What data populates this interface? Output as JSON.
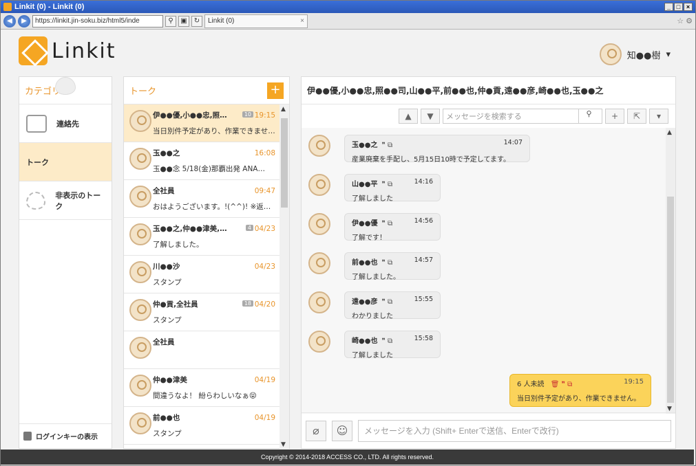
{
  "browser": {
    "window_title": "Linkit (0) - Linkit (0)",
    "address": "https://linkit.jin-soku.biz/html5/inde",
    "tab_label": "Linkit (0)"
  },
  "app": {
    "logo_text": "Linkit",
    "user_name": "知●●樹"
  },
  "category": {
    "header": "カテゴリ",
    "items": [
      {
        "label": "連絡先"
      },
      {
        "label": "トーク"
      },
      {
        "label": "非表示のトーク"
      }
    ],
    "login_key": "ログインキーの表示"
  },
  "talk": {
    "header": "トーク",
    "add_label": "+",
    "items": [
      {
        "name": "伊●●優,小●●忠,照…",
        "message": "当日別件予定があり、作業できませ…",
        "date": "19:15",
        "count": "10"
      },
      {
        "name": "玉●●之",
        "message": "玉●●念 5/18(金)那覇出発 ANA…",
        "date": "16:08",
        "count": ""
      },
      {
        "name": "全社員",
        "message": "おはようございます。!(^^)! ※返…",
        "date": "09:47",
        "count": ""
      },
      {
        "name": "玉●●之,仲●●津美,…",
        "message": "了解しました。",
        "date": "04/23",
        "count": "4"
      },
      {
        "name": "川●●沙",
        "message": "スタンプ",
        "date": "04/23",
        "count": ""
      },
      {
        "name": "仲●貢,全社員",
        "message": "スタンプ",
        "date": "04/20",
        "count": "18"
      },
      {
        "name": "全社員",
        "message": "",
        "date": "",
        "count": ""
      },
      {
        "name": "仲●●津美",
        "message": "間違うなよ！ 紛らわしいなぁ😝",
        "date": "04/19",
        "count": ""
      },
      {
        "name": "前●●也",
        "message": "スタンプ",
        "date": "04/19",
        "count": ""
      }
    ]
  },
  "chat": {
    "title": "伊●●優,小●●忠,照●●司,山●●平,前●●也,仲●貢,遠●●彦,崎●●也,玉●●之",
    "search_placeholder": "メッセージを検索する",
    "messages": [
      {
        "name": "玉●●之",
        "time": "14:07",
        "text": "産業廃棄を手配し、5月15日10時で予定してます。"
      },
      {
        "name": "山●●平",
        "time": "14:16",
        "text": "了解しました"
      },
      {
        "name": "伊●●優",
        "time": "14:56",
        "text": "了解です！"
      },
      {
        "name": "前●●也",
        "time": "14:57",
        "text": "了解しました。"
      },
      {
        "name": "遠●●彦",
        "time": "15:55",
        "text": "わかりました"
      },
      {
        "name": "崎●●也",
        "time": "15:58",
        "text": "了解しました"
      }
    ],
    "own": {
      "unread": "6 人未読",
      "time": "19:15",
      "text": "当日別件予定があり、作業できません。"
    },
    "compose_placeholder": "メッセージを入力 (Shift+ Enterで送信、Enterで改行)"
  },
  "footer": "Copyright © 2014-2018 ACCESS CO., LTD. All rights reserved.",
  "colors": {
    "accent": "#f5a623",
    "active_bg": "#fdebc8",
    "own_bubble": "#fbd35a"
  }
}
